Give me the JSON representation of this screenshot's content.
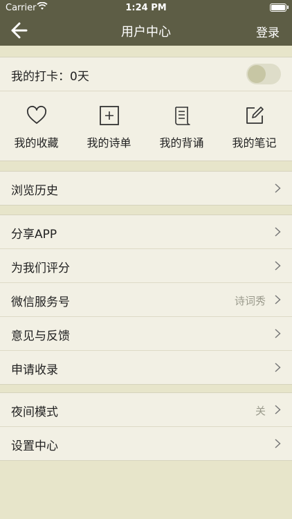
{
  "status_bar": {
    "carrier": "Carrier",
    "time": "1:24 PM"
  },
  "nav": {
    "title": "用户中心",
    "login": "登录"
  },
  "checkin": {
    "label": "我的打卡：0天",
    "toggle_on": false
  },
  "quick_actions": [
    {
      "label": "我的收藏",
      "icon": "heart-icon"
    },
    {
      "label": "我的诗单",
      "icon": "plus-square-icon"
    },
    {
      "label": "我的背诵",
      "icon": "scroll-icon"
    },
    {
      "label": "我的笔记",
      "icon": "edit-note-icon"
    }
  ],
  "history": {
    "label": "浏览历史"
  },
  "group2": [
    {
      "label": "分享APP",
      "value": ""
    },
    {
      "label": "为我们评分",
      "value": ""
    },
    {
      "label": "微信服务号",
      "value": "诗词秀"
    },
    {
      "label": "意见与反馈",
      "value": ""
    },
    {
      "label": "申请收录",
      "value": ""
    }
  ],
  "group3": [
    {
      "label": "夜间模式",
      "value": "关"
    },
    {
      "label": "设置中心",
      "value": ""
    }
  ],
  "colors": {
    "header": "#5d5d45",
    "background": "#e7e5ca",
    "card": "#f2f0e4"
  }
}
